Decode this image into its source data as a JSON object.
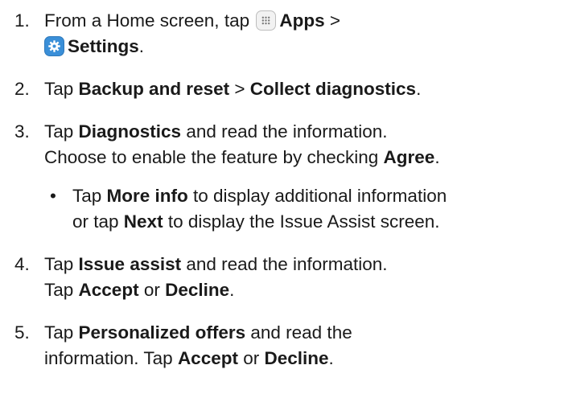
{
  "steps": [
    {
      "number": "1.",
      "t1": "From a Home screen, tap ",
      "apps_label": "Apps",
      "sep": " >",
      "settings_label": "Settings",
      "end": "."
    },
    {
      "number": "2.",
      "t1": "Tap ",
      "b1": "Backup and reset",
      "t2": " > ",
      "b2": "Collect diagnostics",
      "end": "."
    },
    {
      "number": "3.",
      "t1": "Tap ",
      "b1": "Diagnostics",
      "t2": " and read the information.",
      "t3": "Choose to enable the feature by checking ",
      "b2": "Agree",
      "end": "."
    },
    {
      "number": "4.",
      "t1": "Tap ",
      "b1": "Issue assist",
      "t2": " and read the information.",
      "t3": "Tap ",
      "b2": "Accept",
      "t4": " or ",
      "b3": "Decline",
      "end": "."
    },
    {
      "number": "5.",
      "t1": "Tap ",
      "b1": "Personalized offers",
      "t2": " and read the",
      "t3": "information. Tap ",
      "b2": "Accept",
      "t4": " or ",
      "b3": "Decline",
      "end": "."
    }
  ],
  "bullet": {
    "mark": "•",
    "t1": "Tap ",
    "b1": "More info",
    "t2": " to display additional information",
    "t3": "or tap ",
    "b2": "Next",
    "t4": " to display the Issue Assist screen."
  },
  "icons": {
    "apps": "apps-icon",
    "settings": "gear-icon",
    "settings_color": "#3a8fd8"
  }
}
